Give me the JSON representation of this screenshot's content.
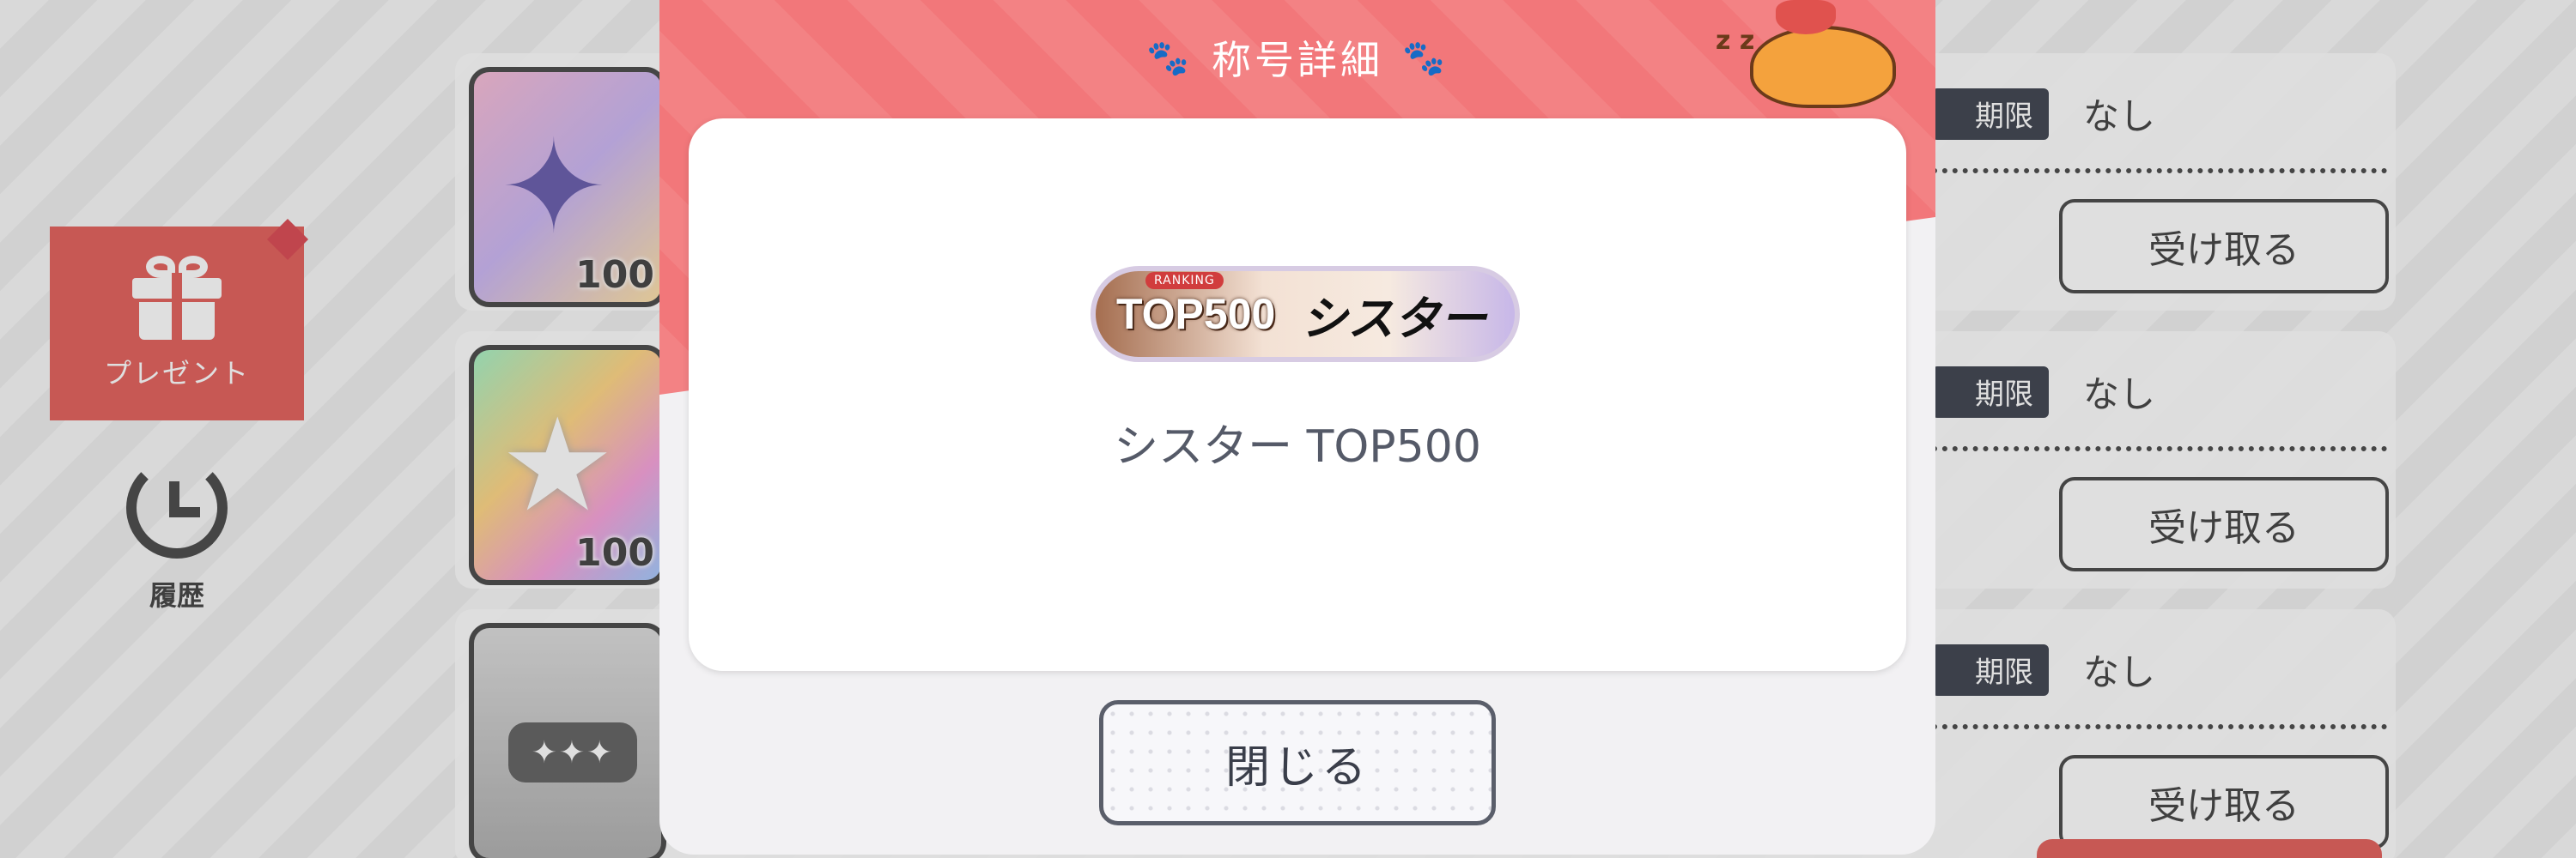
{
  "sidebar": {
    "present_label": "プレゼント",
    "history_label": "履歴"
  },
  "list": {
    "items": [
      {
        "quantity": "100",
        "deadline_tag": "期限",
        "deadline_value": "なし",
        "claim_label": "受け取る"
      },
      {
        "quantity": "100",
        "deadline_tag": "期限",
        "deadline_value": "なし",
        "claim_label": "受け取る"
      },
      {
        "quantity": "",
        "deadline_tag": "期限",
        "deadline_value": "なし",
        "claim_label": "受け取る"
      }
    ]
  },
  "modal": {
    "title": "称号詳細",
    "badge": {
      "ranking_label": "RANKING",
      "rank": "TOP500",
      "name": "シスター"
    },
    "title_name": "シスター TOP500",
    "close_label": "閉じる"
  },
  "colors": {
    "accent_red": "#e0524e",
    "header_pink": "#f2777a",
    "dark_tag": "#2f3440"
  }
}
